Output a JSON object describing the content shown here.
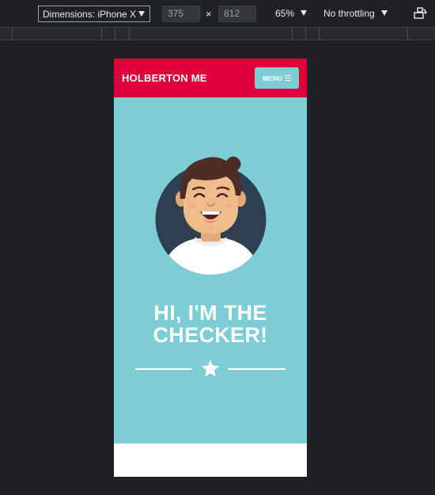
{
  "devtools": {
    "dimensions_label": "Dimensions: iPhone X",
    "width_value": "375",
    "height_value": "812",
    "times": "×",
    "zoom_label": "65%",
    "throttling_label": "No throttling"
  },
  "site": {
    "brand": "HOLBERTON ME",
    "menu_label": "MENU",
    "hero_title_line1": "HI, I'M THE",
    "hero_title_line2": "CHECKER!"
  },
  "colors": {
    "header_red": "#e0003a",
    "hero_teal": "#7ccdd4",
    "avatar_circle": "#2e3f52"
  },
  "icons": [
    "chevron-down-icon",
    "rotate-icon",
    "hamburger-icon",
    "star-icon"
  ]
}
